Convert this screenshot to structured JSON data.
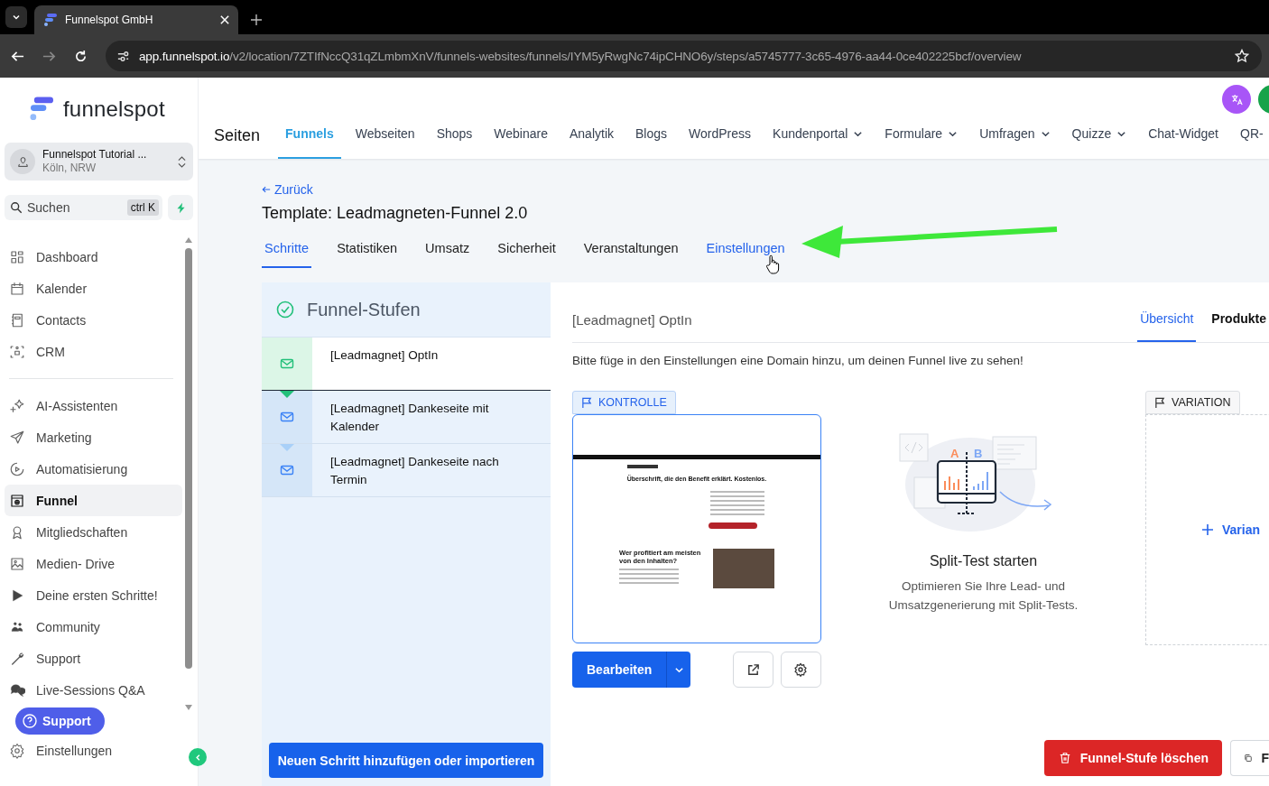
{
  "browser": {
    "tab_title": "Funnelspot GmbH",
    "url_host": "app.funnelspot.io",
    "url_path": "/v2/location/7ZTIfNccQ31qZLmbmXnV/funnels-websites/funnels/IYM5yRwgNc74ipCHNO6y/steps/a5745777-3c65-4976-aa44-0ce402225bcf/overview"
  },
  "sidebar": {
    "logo_text": "funnelspot",
    "account": {
      "name": "Funnelspot Tutorial ...",
      "location": "Köln, NRW"
    },
    "search": {
      "placeholder": "Suchen",
      "shortcut": "ctrl K"
    },
    "sections": [
      {
        "items": [
          {
            "label": "Dashboard",
            "selected": false
          },
          {
            "label": "Kalender",
            "selected": false
          },
          {
            "label": "Contacts",
            "selected": false
          },
          {
            "label": "CRM",
            "selected": false
          }
        ]
      },
      {
        "items": [
          {
            "label": "AI-Assistenten",
            "selected": false
          },
          {
            "label": "Marketing",
            "selected": false
          },
          {
            "label": "Automatisierung",
            "selected": false
          },
          {
            "label": "Funnel",
            "selected": true
          },
          {
            "label": "Mitgliedschaften",
            "selected": false
          },
          {
            "label": "Medien- Drive",
            "selected": false
          },
          {
            "label": "Deine ersten Schritte!",
            "selected": false
          },
          {
            "label": "Community",
            "selected": false
          },
          {
            "label": "Support",
            "selected": false
          },
          {
            "label": "Live-Sessions Q&A",
            "selected": false
          }
        ]
      }
    ],
    "support_button": "Support",
    "settings_item": "Einstellungen"
  },
  "header": {
    "title": "Seiten",
    "nav": [
      {
        "label": "Funnels",
        "selected": true,
        "dropdown": false
      },
      {
        "label": "Webseiten",
        "selected": false,
        "dropdown": false
      },
      {
        "label": "Shops",
        "selected": false,
        "dropdown": false
      },
      {
        "label": "Webinare",
        "selected": false,
        "dropdown": false
      },
      {
        "label": "Analytik",
        "selected": false,
        "dropdown": false
      },
      {
        "label": "Blogs",
        "selected": false,
        "dropdown": false
      },
      {
        "label": "WordPress",
        "selected": false,
        "dropdown": false
      },
      {
        "label": "Kundenportal",
        "selected": false,
        "dropdown": true
      },
      {
        "label": "Formulare",
        "selected": false,
        "dropdown": true
      },
      {
        "label": "Umfragen",
        "selected": false,
        "dropdown": true
      },
      {
        "label": "Quizze",
        "selected": false,
        "dropdown": true
      },
      {
        "label": "Chat-Widget",
        "selected": false,
        "dropdown": false
      },
      {
        "label": "QR-",
        "selected": false,
        "dropdown": false
      }
    ]
  },
  "page": {
    "back_link": "Zurück",
    "title": "Template: Leadmagneten-Funnel 2.0",
    "tabs": [
      {
        "label": "Schritte",
        "selected": true
      },
      {
        "label": "Statistiken",
        "selected": false
      },
      {
        "label": "Umsatz",
        "selected": false
      },
      {
        "label": "Sicherheit",
        "selected": false
      },
      {
        "label": "Veranstaltungen",
        "selected": false
      },
      {
        "label": "Einstellungen",
        "selected": false
      }
    ]
  },
  "steps_panel": {
    "title": "Funnel-Stufen",
    "steps": [
      {
        "label": "[Leadmagnet] OptIn",
        "selected": true
      },
      {
        "label": "[Leadmagnet] Dankeseite mit Kalender",
        "selected": false
      },
      {
        "label": "[Leadmagnet] Dankeseite nach Termin",
        "selected": false
      }
    ],
    "add_button": "Neuen Schritt hinzufügen oder importieren"
  },
  "detail": {
    "step_name": "[Leadmagnet] OptIn",
    "tabs": [
      {
        "label": "Übersicht",
        "selected": true
      },
      {
        "label": "Produkte",
        "selected": false
      }
    ],
    "notice": "Bitte füge in den Einstellungen eine Domain hinzu, um deinen Funnel live zu sehen!",
    "control": {
      "badge": "KONTROLLE",
      "preview": {
        "headline": "Überschrift, die den Benefit erklärt. Kostenlos.",
        "section_title": "Wer profitiert am meisten von den Inhalten?"
      },
      "edit_button": "Bearbeiten"
    },
    "split_test": {
      "illustration_labels": [
        "A",
        "B"
      ],
      "title": "Split-Test starten",
      "text": "Optimieren Sie Ihre Lead- und Umsatzgenerierung mit Split-Tests."
    },
    "variation": {
      "badge": "VARIATION",
      "add_link": "Varian"
    },
    "delete_button": "Funnel-Stufe löschen",
    "next_button": "F"
  }
}
